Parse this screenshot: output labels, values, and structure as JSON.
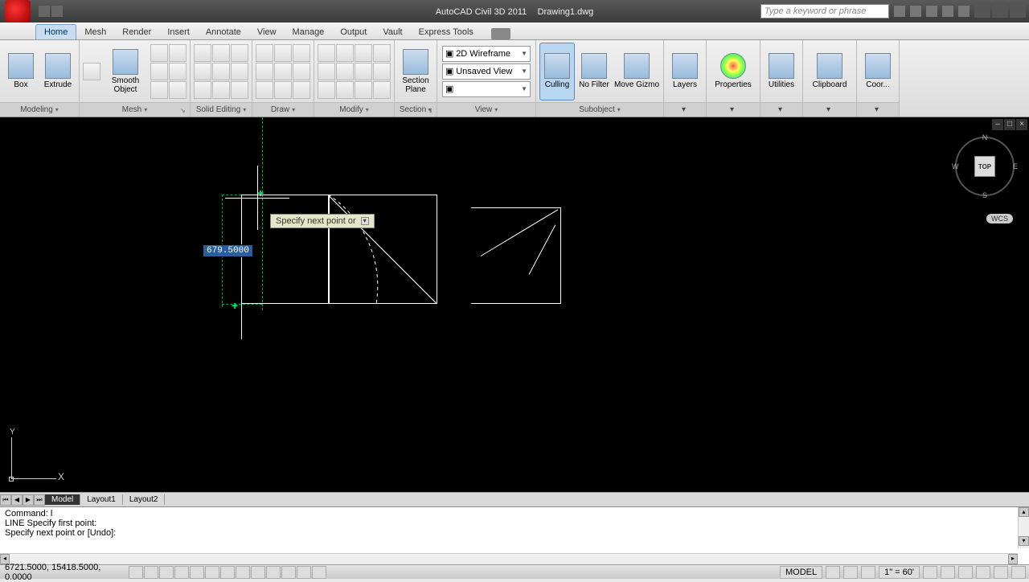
{
  "title": {
    "app": "AutoCAD Civil 3D 2011",
    "doc": "Drawing1.dwg"
  },
  "search": {
    "placeholder": "Type a keyword or phrase"
  },
  "tabs": [
    "Home",
    "Mesh",
    "Render",
    "Insert",
    "Annotate",
    "View",
    "Manage",
    "Output",
    "Vault",
    "Express Tools"
  ],
  "active_tab": 0,
  "panels": {
    "modeling": {
      "title": "Modeling",
      "box": "Box",
      "extrude": "Extrude"
    },
    "mesh": {
      "title": "Mesh",
      "smooth": "Smooth Object"
    },
    "solid": {
      "title": "Solid Editing"
    },
    "draw": {
      "title": "Draw"
    },
    "modify": {
      "title": "Modify"
    },
    "section": {
      "title": "Section",
      "plane": "Section Plane"
    },
    "viewcombo": {
      "title": "View",
      "visual": "2D Wireframe",
      "named": "Unsaved View"
    },
    "culling": {
      "label": "Culling"
    },
    "nofilter": {
      "label": "No Filter"
    },
    "gizmo": {
      "label": "Move Gizmo"
    },
    "subobject": {
      "title": "Subobject"
    },
    "layers": {
      "label": "Layers"
    },
    "props": {
      "label": "Properties"
    },
    "util": {
      "label": "Utilities"
    },
    "clip": {
      "label": "Clipboard"
    },
    "coor": {
      "label": "Coor..."
    }
  },
  "viewcube": {
    "face": "TOP",
    "n": "N",
    "s": "S",
    "e": "E",
    "w": "W",
    "wcs": "WCS"
  },
  "dynamic_input": {
    "value": "679.5000",
    "tooltip": "Specify next point or",
    "arrow": "▾"
  },
  "ucs": {
    "x": "X",
    "y": "Y"
  },
  "layout_tabs": [
    "Model",
    "Layout1",
    "Layout2"
  ],
  "cmd": {
    "line1": "Command: l",
    "line2": "LINE Specify first point:",
    "line3": "Specify next point or [Undo]:"
  },
  "status": {
    "coords": "6721.5000, 15418.5000, 0.0000",
    "model": "MODEL",
    "scale": "1\" = 60'"
  },
  "colors": {
    "accent": "#295f9e",
    "track_green": "#0a5"
  }
}
